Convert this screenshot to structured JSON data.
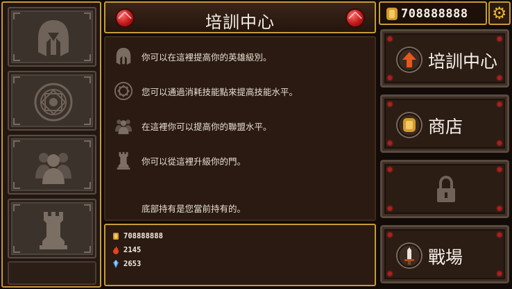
{
  "header": {
    "title": "培訓中心",
    "gold": "708888888"
  },
  "left_tabs": [
    {
      "name": "hero",
      "icon": "spartan-helmet-icon"
    },
    {
      "name": "skill",
      "icon": "rune-circle-icon"
    },
    {
      "name": "alliance",
      "icon": "group-people-icon"
    },
    {
      "name": "gate",
      "icon": "rook-tower-icon"
    }
  ],
  "descriptions": [
    {
      "icon": "spartan-helmet-icon",
      "text": "你可以在這裡提高你的英雄級別。"
    },
    {
      "icon": "rune-circle-icon",
      "text": "您可以通過消耗技能點來提高技能水平。"
    },
    {
      "icon": "group-people-icon",
      "text": "在這裡你可以提高你的聯盟水平。"
    },
    {
      "icon": "rook-tower-icon",
      "text": "你可以從這裡升級你的門。"
    }
  ],
  "footer_text": "底部持有是您當前持有的。",
  "resources": {
    "gold": "708888888",
    "fire": "2145",
    "crystal": "2653"
  },
  "menu": [
    {
      "label": "培訓中心",
      "icon": "upgrade-arrow-icon"
    },
    {
      "label": "商店",
      "icon": "gold-coin-icon"
    },
    {
      "label": "",
      "icon": "padlock-icon"
    },
    {
      "label": "戰場",
      "icon": "sword-icon"
    }
  ],
  "colors": {
    "border_gold": "#c89a3a",
    "panel_brown": "#2a1a11",
    "gem_red": "#c01818",
    "arrow_orange": "#e8571a"
  }
}
